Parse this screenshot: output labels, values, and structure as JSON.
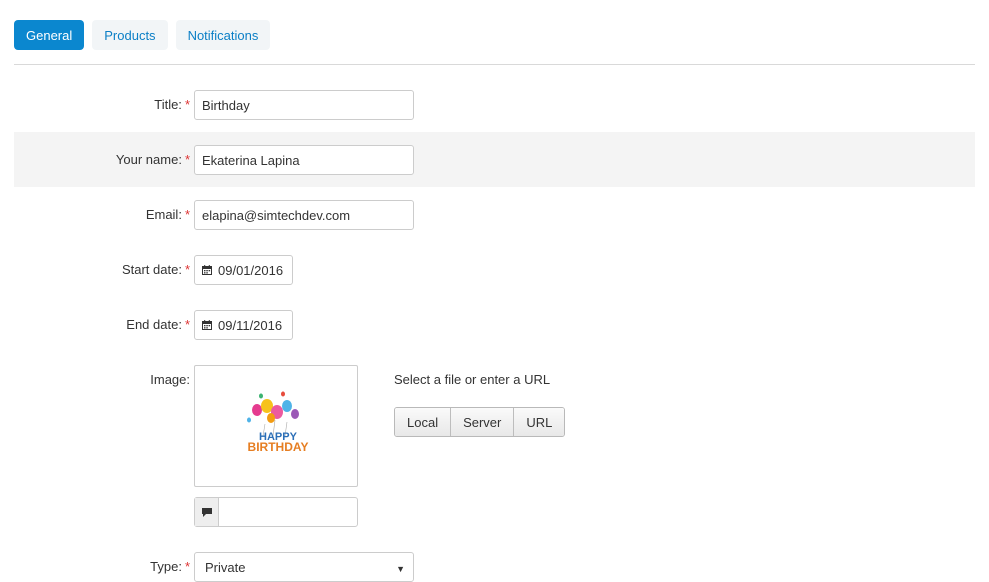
{
  "tabs": [
    {
      "label": "General",
      "active": true
    },
    {
      "label": "Products",
      "active": false
    },
    {
      "label": "Notifications",
      "active": false
    }
  ],
  "form": {
    "title": {
      "label": "Title:",
      "value": "Birthday"
    },
    "your_name": {
      "label": "Your name:",
      "value": "Ekaterina Lapina"
    },
    "email": {
      "label": "Email:",
      "value": "elapina@simtechdev.com"
    },
    "start_date": {
      "label": "Start date:",
      "value": "09/01/2016"
    },
    "end_date": {
      "label": "End date:",
      "value": "09/11/2016"
    },
    "image": {
      "label": "Image:",
      "select_text": "Select a file or enter a URL",
      "buttons": [
        "Local",
        "Server",
        "URL"
      ],
      "alt_value": "",
      "preview_text_1": "HAPPY",
      "preview_text_2": "BIRTHDAY"
    },
    "type": {
      "label": "Type:",
      "value": "Private"
    }
  },
  "required_mark": "*",
  "colors": {
    "accent": "#0b87cf",
    "required": "#dd3333",
    "row_highlight": "#f4f4f4"
  }
}
